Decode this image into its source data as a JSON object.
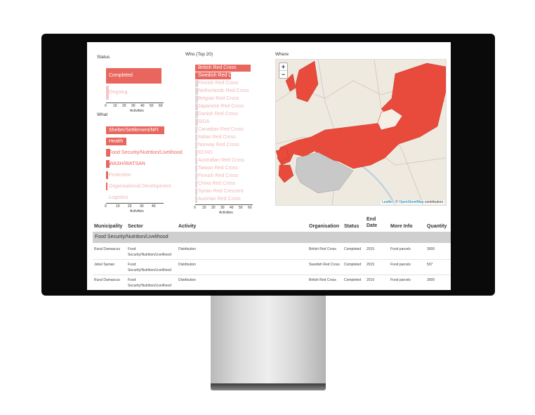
{
  "status": {
    "title": "Status",
    "bars": [
      {
        "label": "Completed",
        "value": 52
      },
      {
        "label": "Ongoing",
        "value": 3
      }
    ],
    "ticks": [
      "0",
      "10",
      "20",
      "30",
      "40",
      "50",
      "60"
    ],
    "axis_label": "Activities"
  },
  "what": {
    "title": "What",
    "bars": [
      {
        "label": "Shelter/Settlement/NFI",
        "value": 48
      },
      {
        "label": "Health",
        "value": 20
      },
      {
        "label": "Food Security/Nutrition/Livelihood",
        "value": 5
      },
      {
        "label": "WASH/WATSAN",
        "value": 3
      },
      {
        "label": "Protection",
        "value": 2
      },
      {
        "label": "Organisational Development",
        "value": 1
      },
      {
        "label": "Logistics",
        "value": 0
      }
    ],
    "ticks": [
      "0",
      "10",
      "20",
      "30",
      "40"
    ],
    "axis_label": "Activities"
  },
  "who": {
    "title": "Who (Top 20)",
    "bars": [
      {
        "label": "British Red Cross",
        "value": 52
      },
      {
        "label": "Swedish Red Cross",
        "value": 18
      },
      {
        "label": "Finnish Red Cross",
        "value": 2
      },
      {
        "label": "Netherlands Red Cross",
        "value": 2
      },
      {
        "label": "Belgian Red Cross",
        "value": 2
      },
      {
        "label": "Japanese Red Cross",
        "value": 2
      },
      {
        "label": "Danish Red Cross",
        "value": 2
      },
      {
        "label": "SIDA",
        "value": 2
      },
      {
        "label": "Canadian Red Cross",
        "value": 1
      },
      {
        "label": "Italian Red Cross",
        "value": 1
      },
      {
        "label": "Norway Red Cross",
        "value": 1
      },
      {
        "label": "ECHO",
        "value": 1
      },
      {
        "label": "Australian Red Cross",
        "value": 1
      },
      {
        "label": "Taiwan Red Cross",
        "value": 1
      },
      {
        "label": "Finnish Red Cross",
        "value": 1
      },
      {
        "label": "China Red Cross",
        "value": 1
      },
      {
        "label": "Syrian Red Crescent",
        "value": 1
      },
      {
        "label": "Austrian Red Cross",
        "value": 1
      }
    ],
    "ticks": [
      "0",
      "10",
      "20",
      "30",
      "40",
      "50",
      "60"
    ],
    "axis_label": "Activities"
  },
  "where": {
    "title": "Where",
    "zoom_in": "+",
    "zoom_out": "−",
    "attribution_link": "Leaflet",
    "attribution_sep": " | © ",
    "attribution_osm": "OpenStreetMap",
    "attribution_tail": " contributors"
  },
  "table": {
    "headers": [
      "Municipality",
      "Sector",
      "Activity",
      "Organisation",
      "Status",
      "End Date",
      "More Info",
      "Quantity"
    ],
    "group": "Food Security/Nutrition/Livelihood",
    "rows": [
      {
        "municipality": "Rural Damascus",
        "sector": "Food Security/Nutrition/Livelihood",
        "activity": "Distribution",
        "organisation": "British Red Cross",
        "status": "Completed",
        "end_date": "2015",
        "more_info": "Food parcels",
        "quantity": "3000"
      },
      {
        "municipality": "Jebel Saman",
        "sector": "Food Security/Nutrition/Livelihood",
        "activity": "Distribution",
        "organisation": "Swedish Red Cross",
        "status": "Completed",
        "end_date": "2015",
        "more_info": "Food parcels",
        "quantity": "507"
      },
      {
        "municipality": "Rural Damascus",
        "sector": "Food Security/Nutrition/Livelihood",
        "activity": "Distribution",
        "organisation": "British Red Cross",
        "status": "Completed",
        "end_date": "2015",
        "more_info": "Food parcels",
        "quantity": "3000"
      }
    ]
  },
  "colors": {
    "bar_red": "#e8665e",
    "bar_pink": "#f4c6c6",
    "bar_gray": "#e0d4d6",
    "region_red": "#e84a3b",
    "region_gray": "#c8c8c8"
  }
}
